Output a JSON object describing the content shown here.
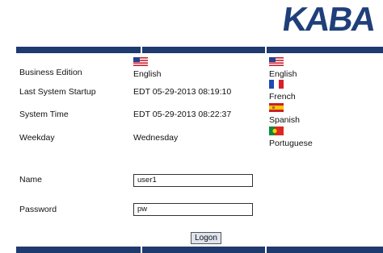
{
  "logo": {
    "text": "KABA"
  },
  "info": {
    "edition_label": "Business Edition",
    "edition_value": "English",
    "startup_label": "Last System Startup",
    "startup_value": "EDT 05-29-2013 08:19:10",
    "time_label": "System Time",
    "time_value": "EDT 05-29-2013 08:22:37",
    "weekday_label": "Weekday",
    "weekday_value": "Wednesday"
  },
  "languages": [
    {
      "label": "English",
      "icon": "us-flag-icon"
    },
    {
      "label": "French",
      "icon": "france-flag-icon"
    },
    {
      "label": "Spanish",
      "icon": "spain-flag-icon"
    },
    {
      "label": "Portuguese",
      "icon": "portugal-flag-icon"
    }
  ],
  "login": {
    "name_label": "Name",
    "name_value": "user1",
    "password_label": "Password",
    "password_value": "pw",
    "logon_label": "Logon"
  },
  "colors": {
    "bar": "#1f3a6e",
    "logo": "#1f3f7a"
  }
}
